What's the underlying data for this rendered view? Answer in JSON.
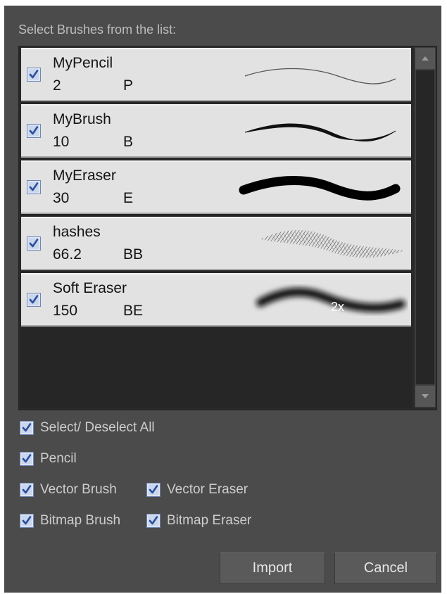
{
  "dialog": {
    "prompt": "Select Brushes from the list:",
    "brushes": [
      {
        "name": "MyPencil",
        "size": "2",
        "shortcut": "P",
        "checked": true,
        "stroke_icon": "thin-pencil-stroke"
      },
      {
        "name": "MyBrush",
        "size": "10",
        "shortcut": "B",
        "checked": true,
        "stroke_icon": "tapered-brush-stroke"
      },
      {
        "name": "MyEraser",
        "size": "30",
        "shortcut": "E",
        "checked": true,
        "stroke_icon": "thick-eraser-stroke"
      },
      {
        "name": "hashes",
        "size": "66.2",
        "shortcut": "BB",
        "checked": true,
        "stroke_icon": "textured-hash-stroke"
      },
      {
        "name": "Soft Eraser",
        "size": "150",
        "shortcut": "BE",
        "checked": true,
        "stroke_icon": "soft-eraser-stroke",
        "preview_scale": "2x"
      }
    ],
    "options": {
      "select_all": "Select/ Deselect All",
      "pencil": "Pencil",
      "vector_brush": "Vector Brush",
      "vector_eraser": "Vector Eraser",
      "bitmap_brush": "Bitmap Brush",
      "bitmap_eraser": "Bitmap Eraser"
    },
    "buttons": {
      "import": "Import",
      "cancel": "Cancel"
    }
  },
  "colors": {
    "checkbox_fill": "#d8e2f0",
    "check_mark": "#2b4f9e",
    "background": "#4b4b4b"
  }
}
